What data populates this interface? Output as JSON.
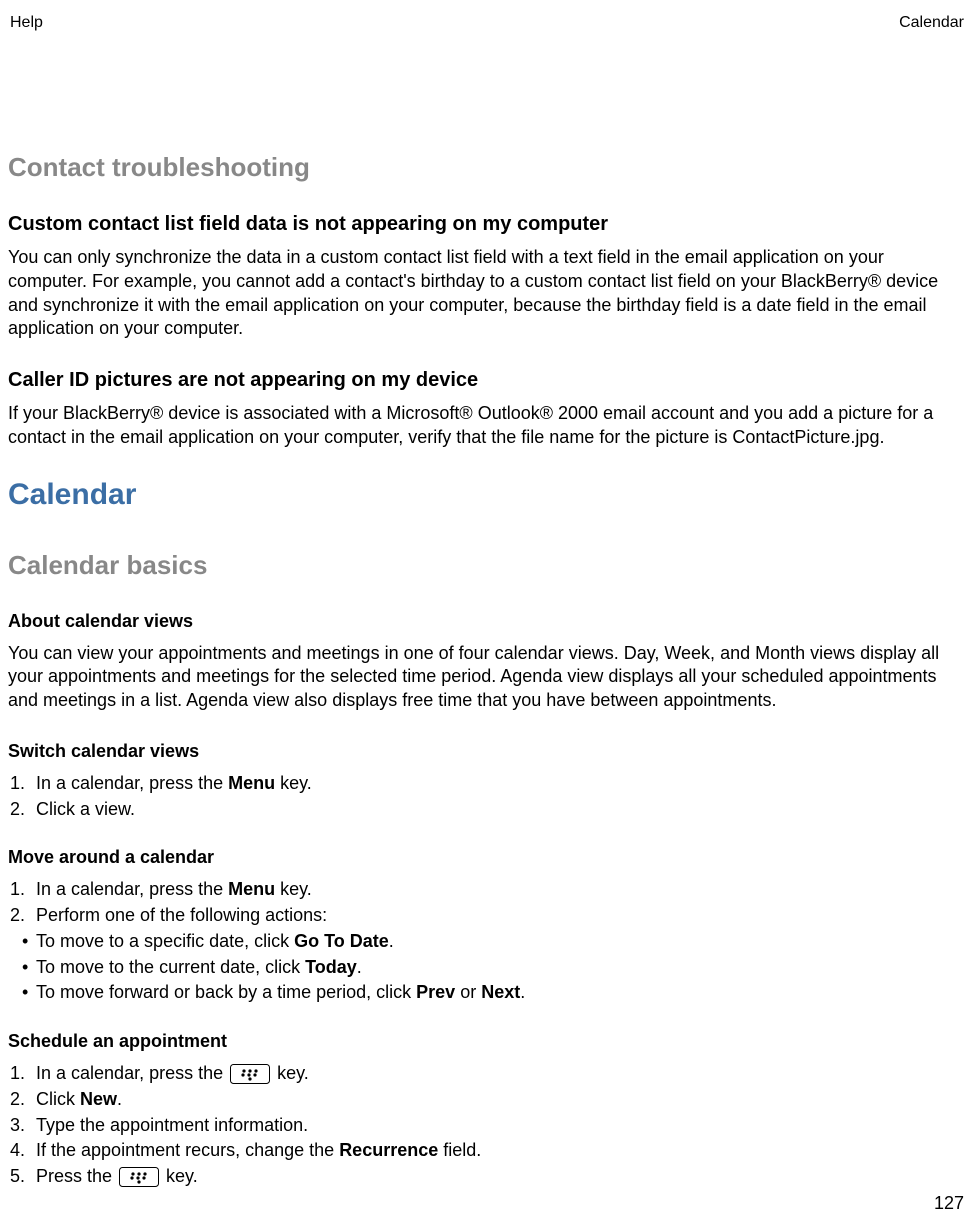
{
  "header": {
    "left": "Help",
    "right": "Calendar"
  },
  "s1": {
    "title": "Contact troubleshooting",
    "sub1_title": "Custom contact list field data is not appearing on my computer",
    "sub1_body": "You can only synchronize the data in a custom contact list field with a text field in the email application on your computer. For example, you cannot add a contact's birthday to a custom contact list field on your BlackBerry® device and synchronize it with the email application on your computer, because the birthday field is a date field in the email application on your computer.",
    "sub2_title": "Caller ID pictures are not appearing on my device",
    "sub2_body": "If your BlackBerry® device is associated with a Microsoft® Outlook® 2000 email account and you add a picture for a contact in the email application on your computer, verify that the file name for the picture is ContactPicture.jpg."
  },
  "s2": {
    "feature_title": "Calendar",
    "basics_title": "Calendar basics",
    "about": {
      "title": "About calendar views",
      "body": "You can view your appointments and meetings in one of four calendar views. Day, Week, and Month views display all your appointments and meetings for the selected time period. Agenda view displays all your scheduled appointments and meetings in a list. Agenda view also displays free time that you have between appointments."
    },
    "switch": {
      "title": "Switch calendar views",
      "step1_a": "In a calendar, press the ",
      "step1_b": "Menu",
      "step1_c": " key.",
      "step2": "Click a view."
    },
    "move": {
      "title": "Move around a calendar",
      "step1_a": "In a calendar, press the ",
      "step1_b": "Menu",
      "step1_c": " key.",
      "step2": "Perform one of the following actions:",
      "b1_a": "To move to a specific date, click ",
      "b1_b": "Go To Date",
      "b1_c": ".",
      "b2_a": "To move to the current date, click ",
      "b2_b": "Today",
      "b2_c": ".",
      "b3_a": "To move forward or back by a time period, click ",
      "b3_b": "Prev",
      "b3_mid": " or ",
      "b3_c": "Next",
      "b3_end": "."
    },
    "schedule": {
      "title": "Schedule an appointment",
      "step1_a": "In a calendar, press the ",
      "step1_c": " key.",
      "step2_a": "Click ",
      "step2_b": "New",
      "step2_c": ".",
      "step3": "Type the appointment information.",
      "step4_a": "If the appointment recurs, change the ",
      "step4_b": "Recurrence",
      "step4_c": " field.",
      "step5_a": "Press the ",
      "step5_c": " key."
    }
  },
  "page_number": "127"
}
